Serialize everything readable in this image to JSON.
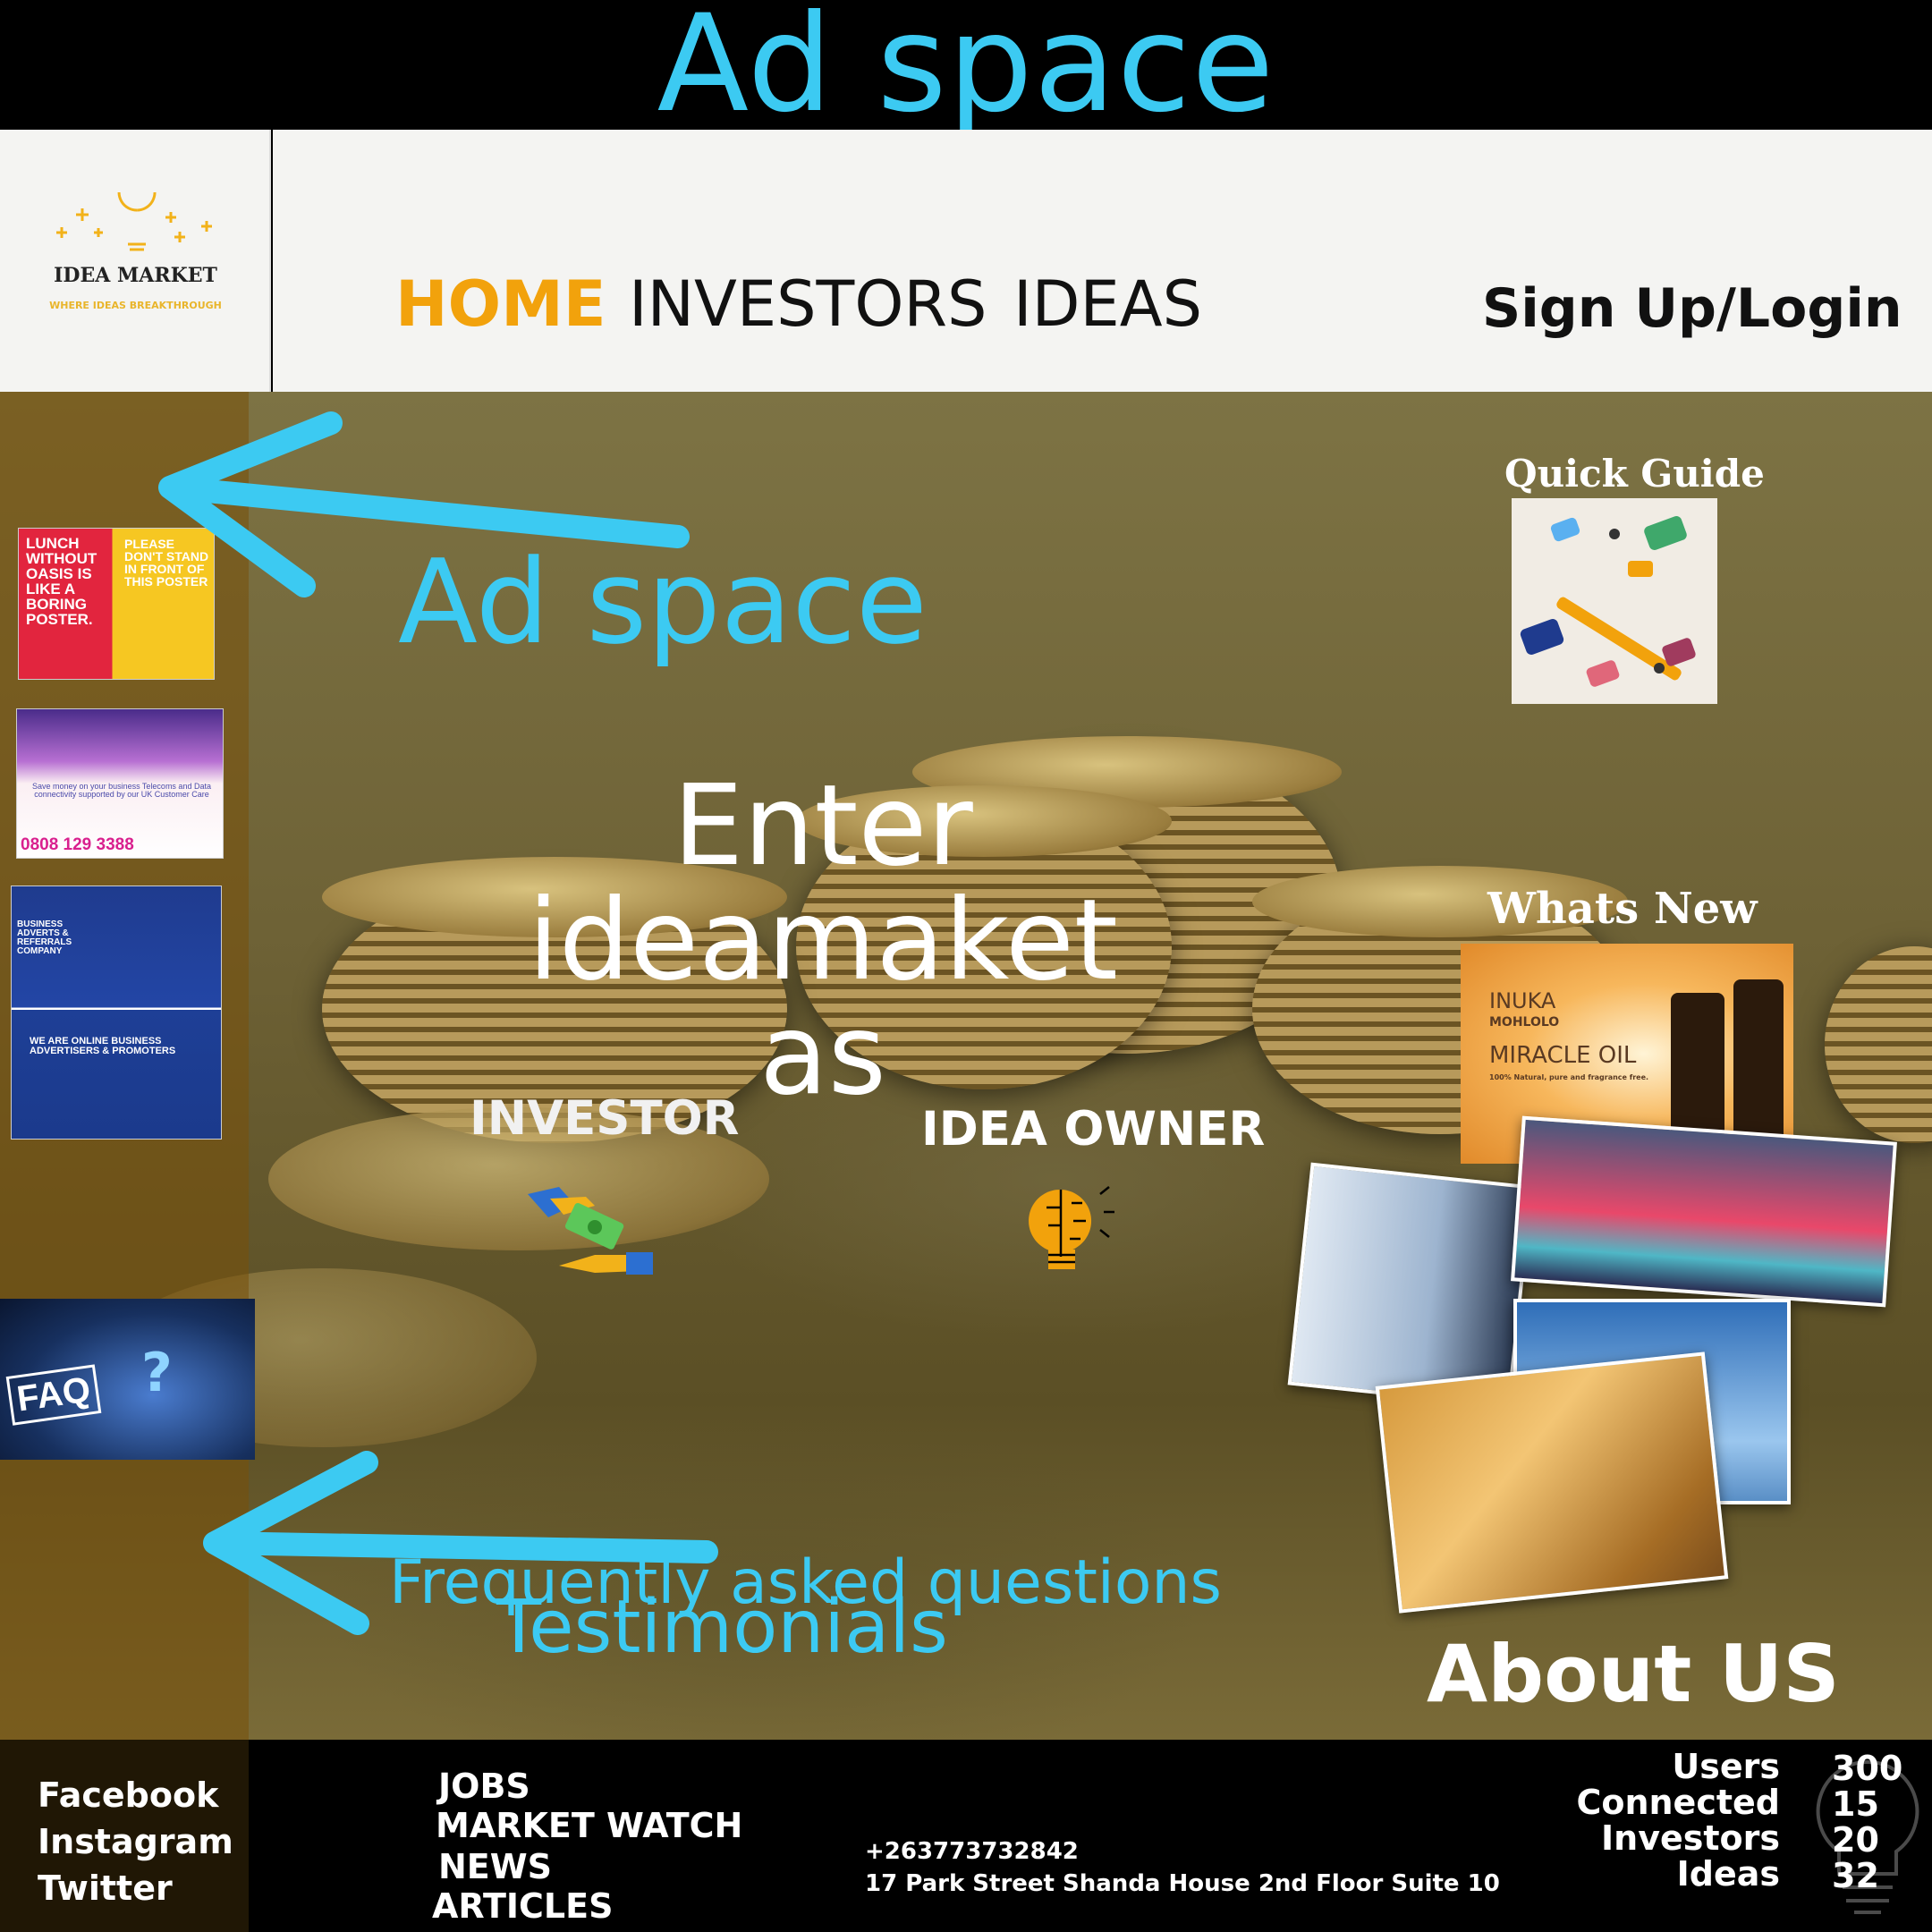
{
  "top_ad": {
    "label": "Ad space"
  },
  "logo": {
    "name": "IDEA MARKET",
    "tagline": "WHERE IDEAS BREAKTHROUGH"
  },
  "nav": {
    "home": "HOME",
    "investors": "INVESTORS",
    "ideas": "IDEAS",
    "signup": "Sign Up/Login"
  },
  "sidebar_ads": {
    "ad1_left": "LUNCH WITHOUT OASIS IS LIKE A BORING POSTER.",
    "ad1_right": "PLEASE DON'T STAND IN FRONT OF THIS POSTER",
    "ad2_text": "Save money on your business Telecoms and Data connectivity supported by our UK Customer Care",
    "ad2_phone": "0808 129 3388",
    "ad3_title": "BUSINESS ADVERTS & REFERRALS COMPANY",
    "ad3_sub": "WE ARE ONLINE BUSINESS ADVERTISERS & PROMOTERS",
    "faq": "FAQ"
  },
  "hero": {
    "ad_space": "Ad space",
    "enter": [
      "Enter",
      "ideamaket",
      "as"
    ],
    "investor": "INVESTOR",
    "idea_owner": "IDEA OWNER",
    "faq_text": "Frequently asked questions",
    "testimonials": "Testimonials",
    "quick_guide": "Quick Guide",
    "whats_new": "Whats New",
    "miracle_brand": "INUKA",
    "miracle_sub": "MOHLOLO",
    "miracle_title": "MIRACLE OIL",
    "miracle_desc": "100% Natural, pure and fragrance free.",
    "about": "About US"
  },
  "footer": {
    "social": [
      "Facebook",
      "Instagram",
      "Twitter"
    ],
    "links": [
      "JOBS",
      "MARKET WATCH",
      "NEWS",
      "ARTICLES"
    ],
    "phone": "+263773732842",
    "address": "17 Park Street Shanda House 2nd Floor Suite 10",
    "stats": [
      {
        "label": "Users",
        "value": "300"
      },
      {
        "label": "Connected",
        "value": "15"
      },
      {
        "label": "Investors",
        "value": "20"
      },
      {
        "label": "Ideas",
        "value": "32"
      }
    ]
  },
  "colors": {
    "accent_blue": "#3ccaf2",
    "home_orange": "#f2a20c"
  }
}
